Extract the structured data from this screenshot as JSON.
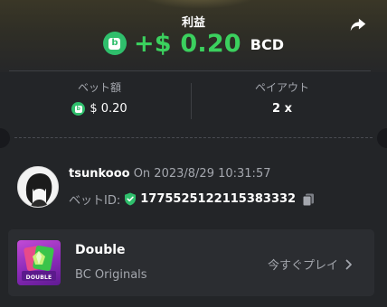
{
  "header": {
    "profit_label": "利益",
    "profit_amount": "+$ 0.20",
    "currency": "BCD",
    "coin_icon": "bc-coin-icon",
    "share_icon": "share-icon"
  },
  "stats": {
    "bet_amount_label": "ベット額",
    "bet_amount_value": "$ 0.20",
    "payout_label": "ペイアウト",
    "payout_value": "2 x"
  },
  "user": {
    "username": "tsunkooo",
    "on_text": "On 2023/8/29 10:31:57",
    "bet_id_label": "ベットID:",
    "bet_id_value": "1775525122115383332",
    "verified_icon": "shield-check-icon",
    "copy_icon": "copy-icon"
  },
  "game": {
    "title": "Double",
    "subtitle": "BC Originals",
    "thumb_text": "DOUBLE",
    "play_label": "今すぐプレイ"
  },
  "colors": {
    "profit_green": "#3bd05e",
    "coin_green": "#2fbf6c",
    "card_bg": "#232528",
    "muted_text": "#a4a7ae"
  }
}
